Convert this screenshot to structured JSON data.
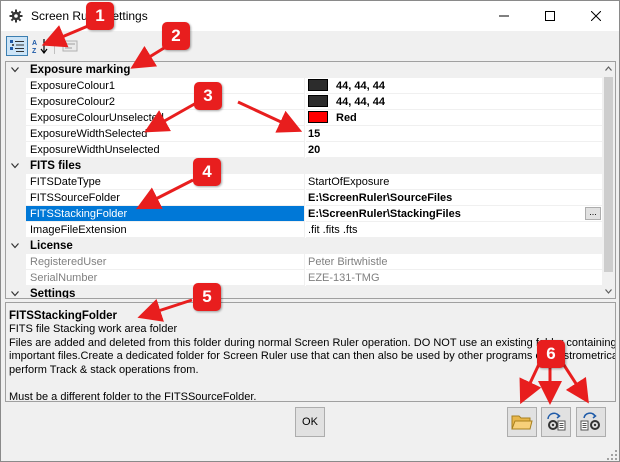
{
  "window": {
    "title": "Screen Ruler Settings",
    "icons": {
      "app": "gear-icon",
      "minimize": "minimize-icon",
      "maximize": "maximize-icon",
      "close": "close-icon"
    }
  },
  "toolbar": {
    "icons": [
      "categorized-icon",
      "alphabetical-sort-icon",
      "property-pages-icon"
    ]
  },
  "grid": {
    "rows": [
      {
        "type": "category",
        "label": "Exposure marking"
      },
      {
        "type": "prop",
        "name": "ExposureColour1",
        "value": "44, 44, 44",
        "swatch": "#2c2c2c",
        "bold": true
      },
      {
        "type": "prop",
        "name": "ExposureColour2",
        "value": "44, 44, 44",
        "swatch": "#2c2c2c",
        "bold": true
      },
      {
        "type": "prop",
        "name": "ExposureColourUnselected",
        "value": "Red",
        "swatch": "#ff0000",
        "bold": true
      },
      {
        "type": "prop",
        "name": "ExposureWidthSelected",
        "value": "15",
        "bold": true
      },
      {
        "type": "prop",
        "name": "ExposureWidthUnselected",
        "value": "20",
        "bold": true
      },
      {
        "type": "category",
        "label": "FITS files"
      },
      {
        "type": "prop",
        "name": "FITSDateType",
        "value": "StartOfExposure"
      },
      {
        "type": "prop",
        "name": "FITSSourceFolder",
        "value": "E:\\ScreenRuler\\SourceFiles",
        "bold": true
      },
      {
        "type": "prop",
        "name": "FITSStackingFolder",
        "value": "E:\\ScreenRuler\\StackingFiles",
        "bold": true,
        "selected": true,
        "button": "..."
      },
      {
        "type": "prop",
        "name": "ImageFileExtension",
        "value": ".fit .fits .fts"
      },
      {
        "type": "category",
        "label": "License"
      },
      {
        "type": "prop",
        "name": "RegisteredUser",
        "value": "Peter Birtwhistle",
        "disabled": true
      },
      {
        "type": "prop",
        "name": "SerialNumber",
        "value": "EZE-131-TMG",
        "disabled": true
      },
      {
        "type": "category",
        "label": "Settings"
      }
    ]
  },
  "help": {
    "title": "FITSStackingFolder",
    "lines": [
      "FITS file Stacking work area folder",
      "Files are added and deleted from this folder during normal Screen Ruler operation. DO NOT use an existing folder containing",
      "important files.Create a dedicated folder for Screen Ruler use that can then also be used by other programs e.g. Astrometrica, to",
      "perform Track & stack operations from.",
      "",
      "Must be a different folder to the FITSSourceFolder."
    ]
  },
  "buttons": {
    "ok": "OK",
    "actions": [
      "open-folder-icon",
      "import-settings-icon",
      "export-settings-icon"
    ]
  },
  "annotations": {
    "badges": [
      "1",
      "2",
      "3",
      "4",
      "5",
      "6"
    ],
    "color": "#e81e1e"
  }
}
